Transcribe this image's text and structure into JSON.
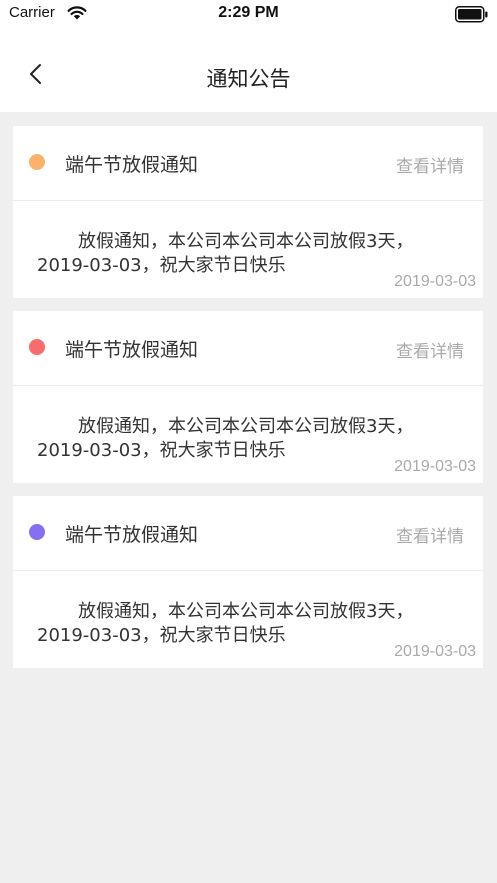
{
  "status_bar": {
    "carrier": "Carrier",
    "time": "2:29 PM"
  },
  "nav": {
    "title": "通知公告"
  },
  "notices": [
    {
      "title": "端午节放假通知",
      "detail_label": "查看详情",
      "content": "放假通知，本公司本公司本公司放假3天，2019-03-03，祝大家节日快乐",
      "date": "2019-03-03",
      "dot_color": "#fbb36b"
    },
    {
      "title": "端午节放假通知",
      "detail_label": "查看详情",
      "content": "放假通知，本公司本公司本公司放假3天，2019-03-03，祝大家节日快乐",
      "date": "2019-03-03",
      "dot_color": "#f76c6c"
    },
    {
      "title": "端午节放假通知",
      "detail_label": "查看详情",
      "content": "放假通知，本公司本公司本公司放假3天，2019-03-03，祝大家节日快乐",
      "date": "2019-03-03",
      "dot_color": "#8770ee"
    }
  ]
}
